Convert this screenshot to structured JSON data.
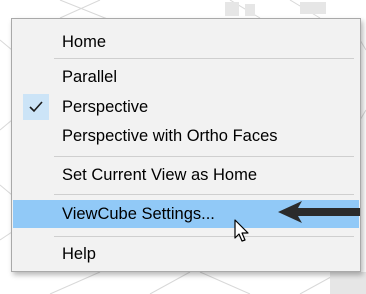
{
  "context_menu": {
    "items": [
      {
        "label": "Home"
      },
      {
        "label": "Parallel"
      },
      {
        "label": "Perspective",
        "checked": true
      },
      {
        "label": "Perspective with Ortho Faces"
      },
      {
        "label": "Set Current View as Home"
      },
      {
        "label": "ViewCube Settings...",
        "highlighted": true
      },
      {
        "label": "Help"
      }
    ]
  },
  "colors": {
    "menu_background": "#f2f2f2",
    "highlight": "#91c9f7",
    "check_background": "#cce4f7",
    "arrow": "#2b2b2b"
  },
  "icons": {
    "checkmark": "checkmark-icon",
    "annotation_arrow": "annotation-arrow-icon",
    "cursor": "mouse-pointer-icon"
  }
}
